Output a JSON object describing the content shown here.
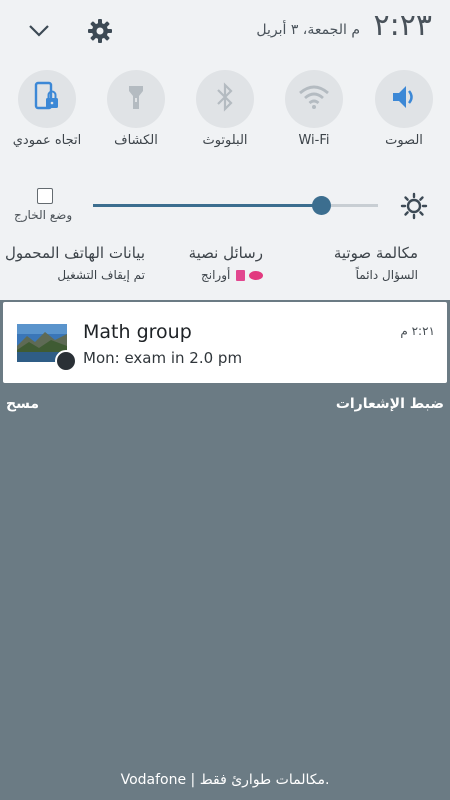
{
  "header": {
    "time": "٢:٢٣",
    "date": "م الجمعة، ٣ أبريل",
    "expand_icon": "chevron-down-icon",
    "settings_icon": "gear-icon"
  },
  "quick_settings": [
    {
      "label": "الصوت",
      "icon": "speaker-icon",
      "active": true
    },
    {
      "label": "Wi-Fi",
      "icon": "wifi-icon",
      "active": false
    },
    {
      "label": "البلوتوث",
      "icon": "bluetooth-icon",
      "active": false
    },
    {
      "label": "الكشاف",
      "icon": "flashlight-icon",
      "active": false
    },
    {
      "label": "اتجاه عمودي",
      "icon": "portrait-lock-icon",
      "active": true
    }
  ],
  "brightness": {
    "outdoor_label": "وضع الخارج",
    "level": 0.8
  },
  "sim_settings": {
    "voice": {
      "title": "مكالمة صوتية",
      "value": "السؤال دائماً"
    },
    "sms": {
      "title": "رسائل نصية",
      "value": "أورانج"
    },
    "data": {
      "title": "بيانات الهاتف المحمول",
      "value": "تم إيقاف التشغيل"
    }
  },
  "notification": {
    "title": "Math group",
    "text": "Mon: exam in 2.0 pm",
    "time": "٢:٢١ م"
  },
  "actions": {
    "settings_label": "ضبط الإشعارات",
    "clear_label": "مسح"
  },
  "footer": {
    "carrier_text": "Vodafone | مكالمات طوارئ فقط."
  },
  "colors": {
    "accent": "#3c88d6",
    "panel_bg": "#f0f2f4",
    "shade_bg": "#6b7b84"
  }
}
